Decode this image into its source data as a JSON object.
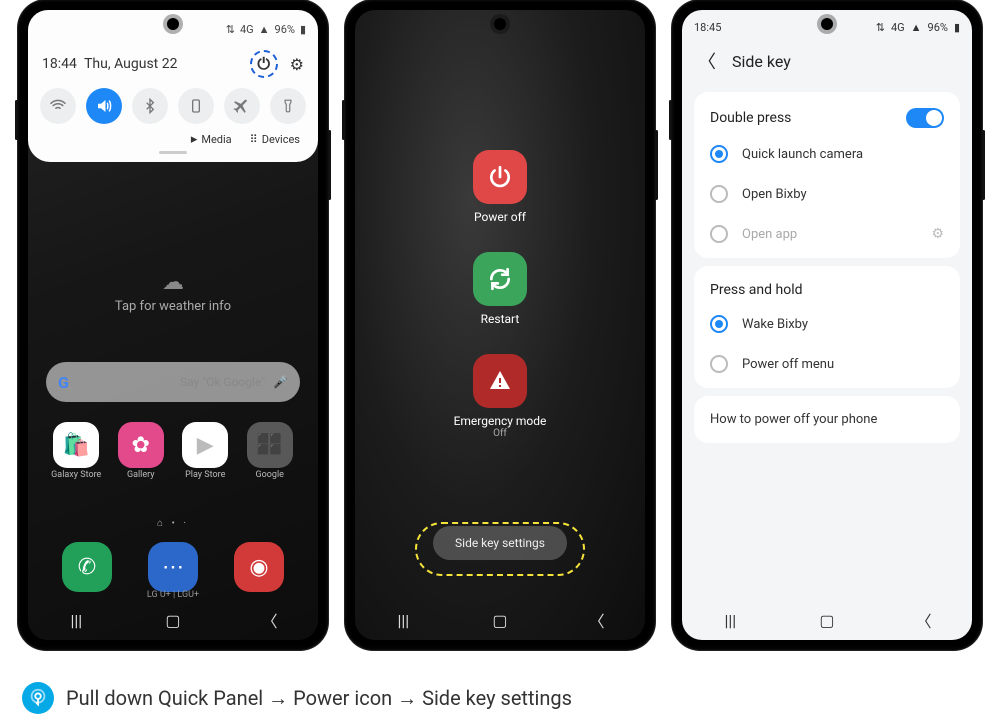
{
  "status": {
    "battery": "96%",
    "network": "4G"
  },
  "phone1": {
    "time": "18:44",
    "date": "Thu, August 22",
    "toggles": {
      "wifi": "wifi",
      "sound": "sound",
      "bluetooth": "bluetooth",
      "rotate": "portrait",
      "airplane": "airplane",
      "flashlight": "flashlight"
    },
    "media_label": "Media",
    "devices_label": "Devices",
    "weather_hint": "Tap for weather info",
    "search_hint": "Say \"Ok Google\"",
    "apps": {
      "galaxy_store": "Galaxy Store",
      "gallery": "Gallery",
      "play_store": "Play Store",
      "google": "Google"
    },
    "carrier": "LG U+ | LGU+"
  },
  "phone2": {
    "power_off": "Power off",
    "restart": "Restart",
    "emergency": "Emergency mode",
    "emergency_sub": "Off",
    "side_key_settings": "Side key settings"
  },
  "phone3": {
    "time": "18:45",
    "title": "Side key",
    "section1_title": "Double press",
    "opt_camera": "Quick launch camera",
    "opt_bixby": "Open Bixby",
    "opt_app": "Open app",
    "section2_title": "Press and hold",
    "opt_wake_bixby": "Wake Bixby",
    "opt_power_menu": "Power off menu",
    "howto": "How to power off your phone"
  },
  "caption": "Pull down Quick Panel → Power icon → Side key settings"
}
